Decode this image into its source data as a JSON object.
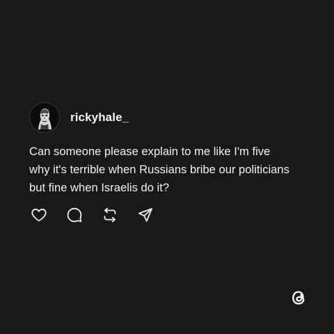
{
  "post": {
    "username": "rickyhale_",
    "text": "Can someone please explain to me like I'm five\nwhy it's terrible when Russians bribe our politicians\nbut fine when Israelis do it?"
  },
  "actions": [
    {
      "icon": "heart-icon"
    },
    {
      "icon": "comment-icon"
    },
    {
      "icon": "repost-icon"
    },
    {
      "icon": "share-icon"
    }
  ],
  "branding": {
    "logo": "threads-logo-icon"
  },
  "colors": {
    "background": "#191919",
    "text": "#f2f2f2",
    "icon": "#f2f2f2"
  }
}
